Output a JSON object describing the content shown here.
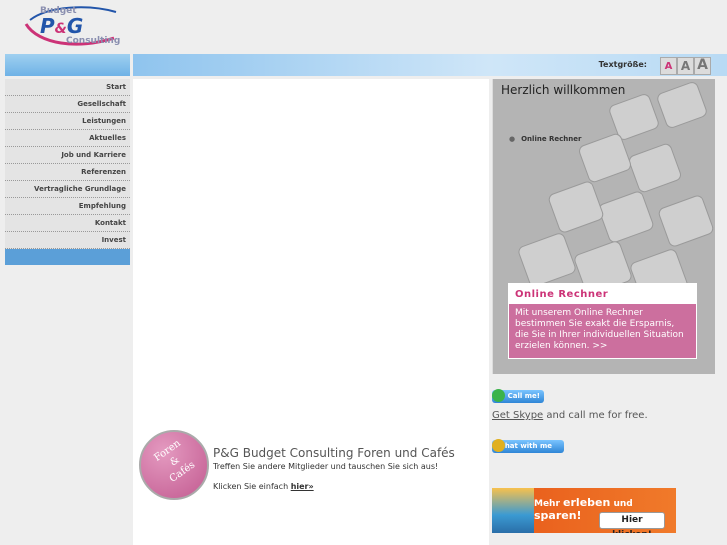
{
  "logo": {
    "top": "Budget",
    "main": "P",
    "amp": "&",
    "main2": "G",
    "bottom": "Consulting"
  },
  "header": {
    "text_size_label": "Textgröße:",
    "size_buttons": [
      "A",
      "A",
      "A"
    ]
  },
  "nav": {
    "items": [
      {
        "label": "Start"
      },
      {
        "label": "Gesellschaft"
      },
      {
        "label": "Leistungen"
      },
      {
        "label": "Aktuelles"
      },
      {
        "label": "Job und Karriere"
      },
      {
        "label": "Referenzen"
      },
      {
        "label": "Vertragliche Grundlage"
      },
      {
        "label": "Empfehlung"
      },
      {
        "label": "Kontakt"
      },
      {
        "label": "Invest"
      }
    ]
  },
  "foren": {
    "badge_line1": "Foren",
    "badge_line2": "&",
    "badge_line3": "Cafés",
    "title": "P&G Budget Consulting Foren und Cafés",
    "subtitle": "Treffen Sie andere Mitglieder und tauschen Sie sich aus!",
    "click_prefix": "Klicken Sie einfach ",
    "click_link": "hier»"
  },
  "welcome": {
    "title": "Herzlich willkommen",
    "item": "Online Rechner",
    "promo_heading": "Online Rechner",
    "promo_text": "Mit unserem Online Rechner bestimmen Sie exakt die Ersparnis, die Sie in Ihrer individuellen Situation erzielen können. >>"
  },
  "skype": {
    "call_button": "Call me!",
    "get_skype": "Get Skype",
    "get_skype_suffix": " and call me for free.",
    "chat_button": "Chat with me"
  },
  "banner": {
    "text_pre": "Mehr ",
    "text_b1": "erleben",
    "text_mid": " und ",
    "text_b2": "sparen!",
    "button": "Hier klicken!"
  }
}
